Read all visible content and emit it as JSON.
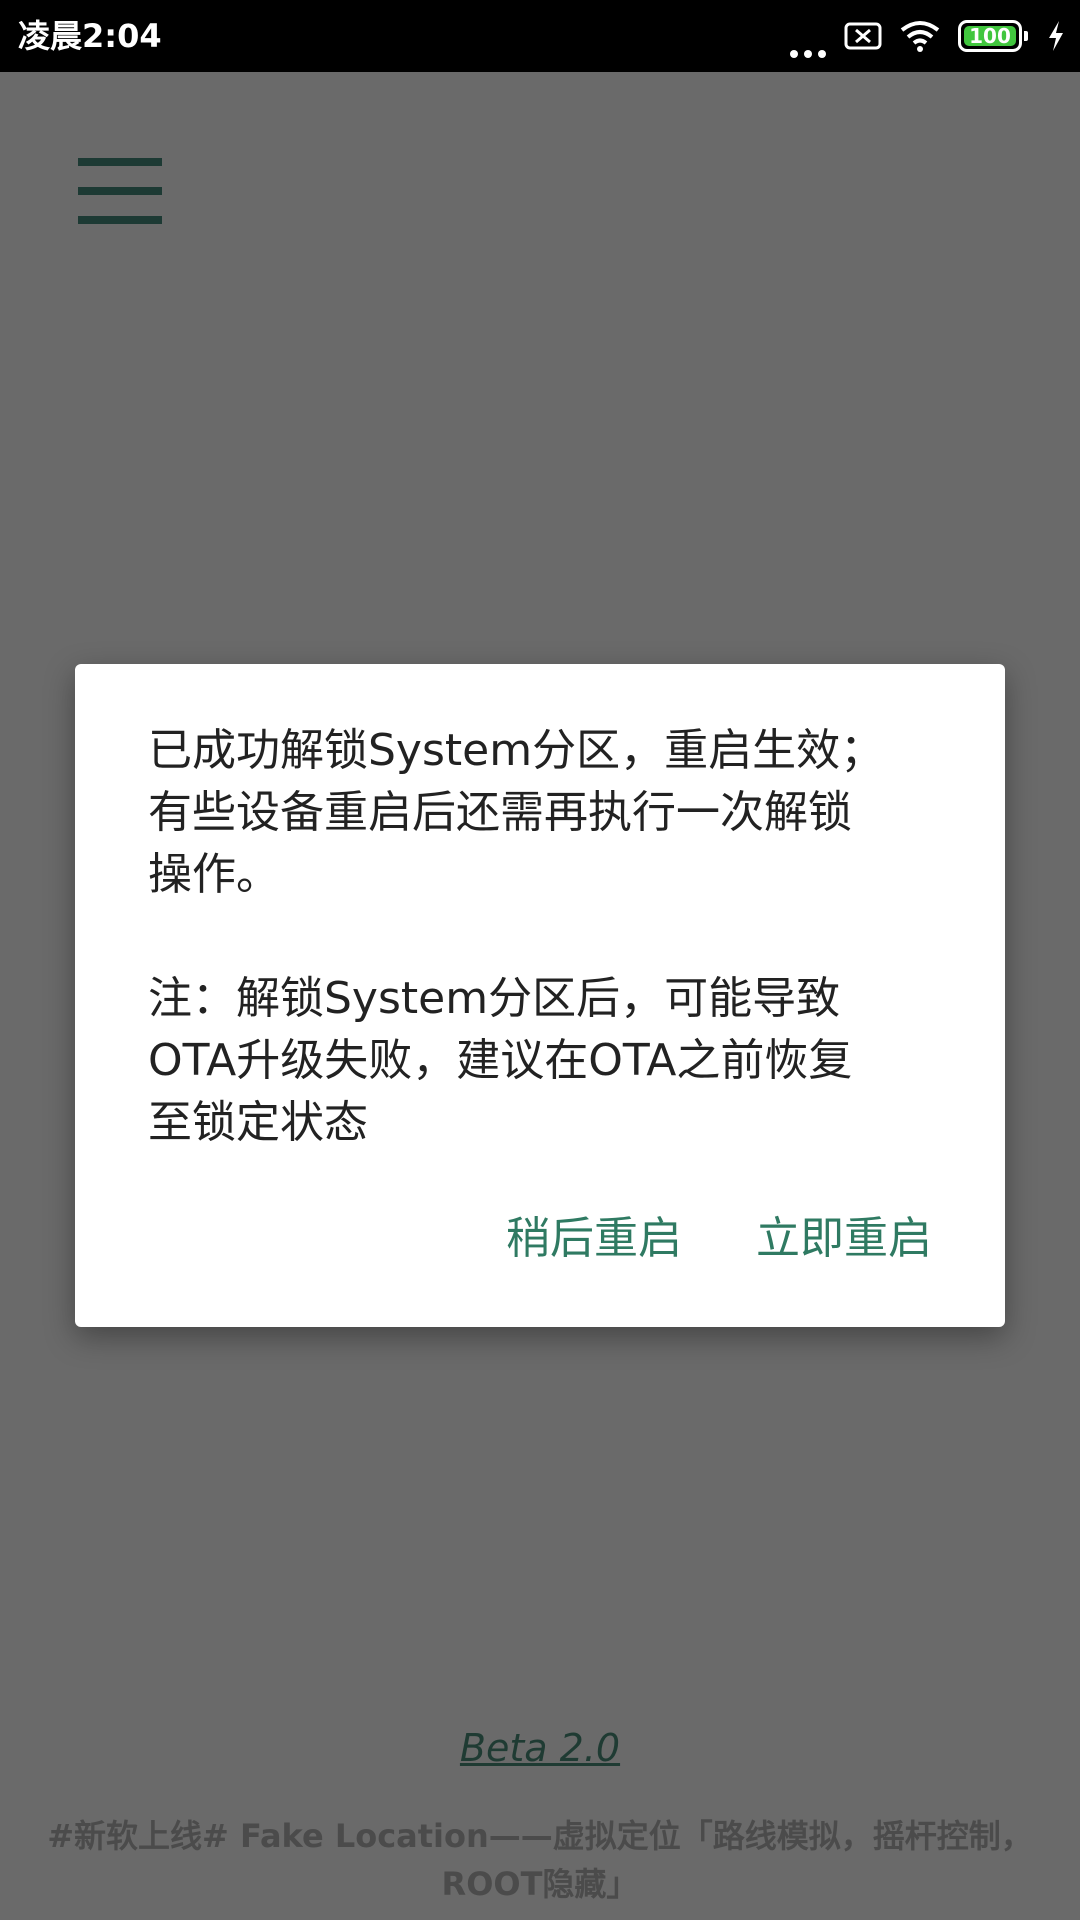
{
  "status_bar": {
    "time": "凌晨2:04",
    "battery": "100",
    "icons": [
      "more-dots-icon",
      "no-sim-icon",
      "wifi-icon",
      "battery-icon",
      "charging-icon"
    ]
  },
  "app": {
    "menu_icon": "hamburger-menu-icon",
    "version": "Beta 2.0",
    "promo": "#新软上线# Fake Location——虚拟定位「路线模拟，摇杆控制，ROOT隐藏」"
  },
  "dialog": {
    "message": "已成功解锁System分区，重启生效；\n有些设备重启后还需再执行一次解锁\n操作。\n\n注：解锁System分区后，可能导致\nOTA升级失败，建议在OTA之前恢复\n至锁定状态",
    "later_button": "稍后重启",
    "now_button": "立即重启"
  },
  "colors": {
    "scrim": "#6a6a6a",
    "accent": "#2f7a62",
    "menu": "#1d3a34",
    "battery": "#41c63e"
  }
}
